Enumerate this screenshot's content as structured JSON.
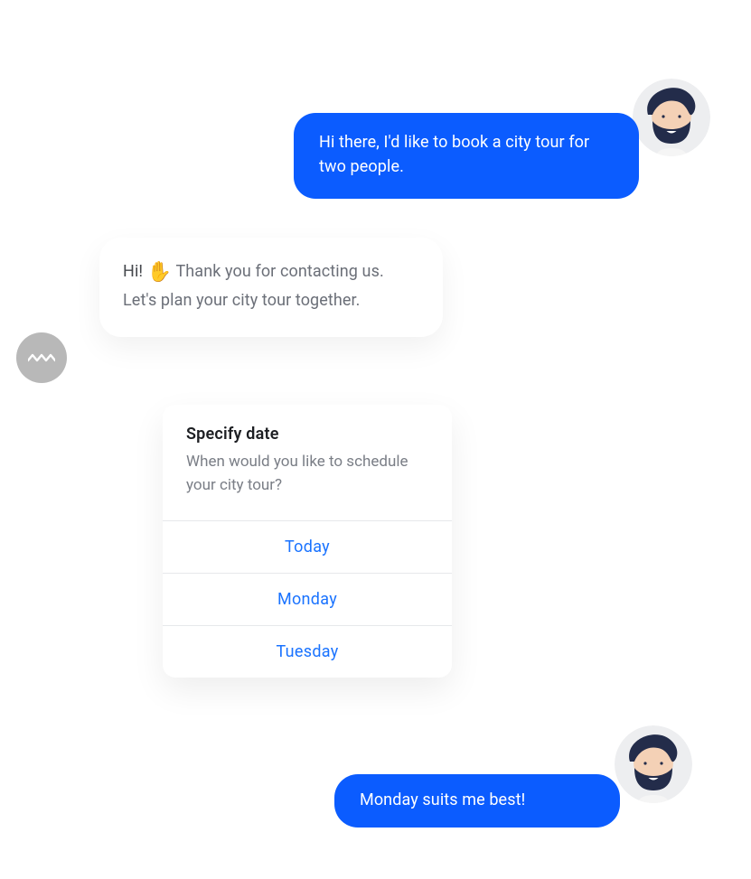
{
  "messages": {
    "user1": "Hi there, I'd like to book a city tour for two people.",
    "bot_hi": "Hi! ",
    "bot_rest": " Thank you for contacting us. Let's plan your city tour together.",
    "user2": "Monday suits me best!"
  },
  "date_card": {
    "title": "Specify date",
    "subtitle": "When would you like to schedule your city tour?",
    "options": [
      "Today",
      "Monday",
      "Tuesday"
    ]
  },
  "colors": {
    "primary": "#0b5cff",
    "link": "#1a73ff",
    "text_muted": "#6b6f78",
    "bot_avatar_bg": "#b8b8b8"
  }
}
